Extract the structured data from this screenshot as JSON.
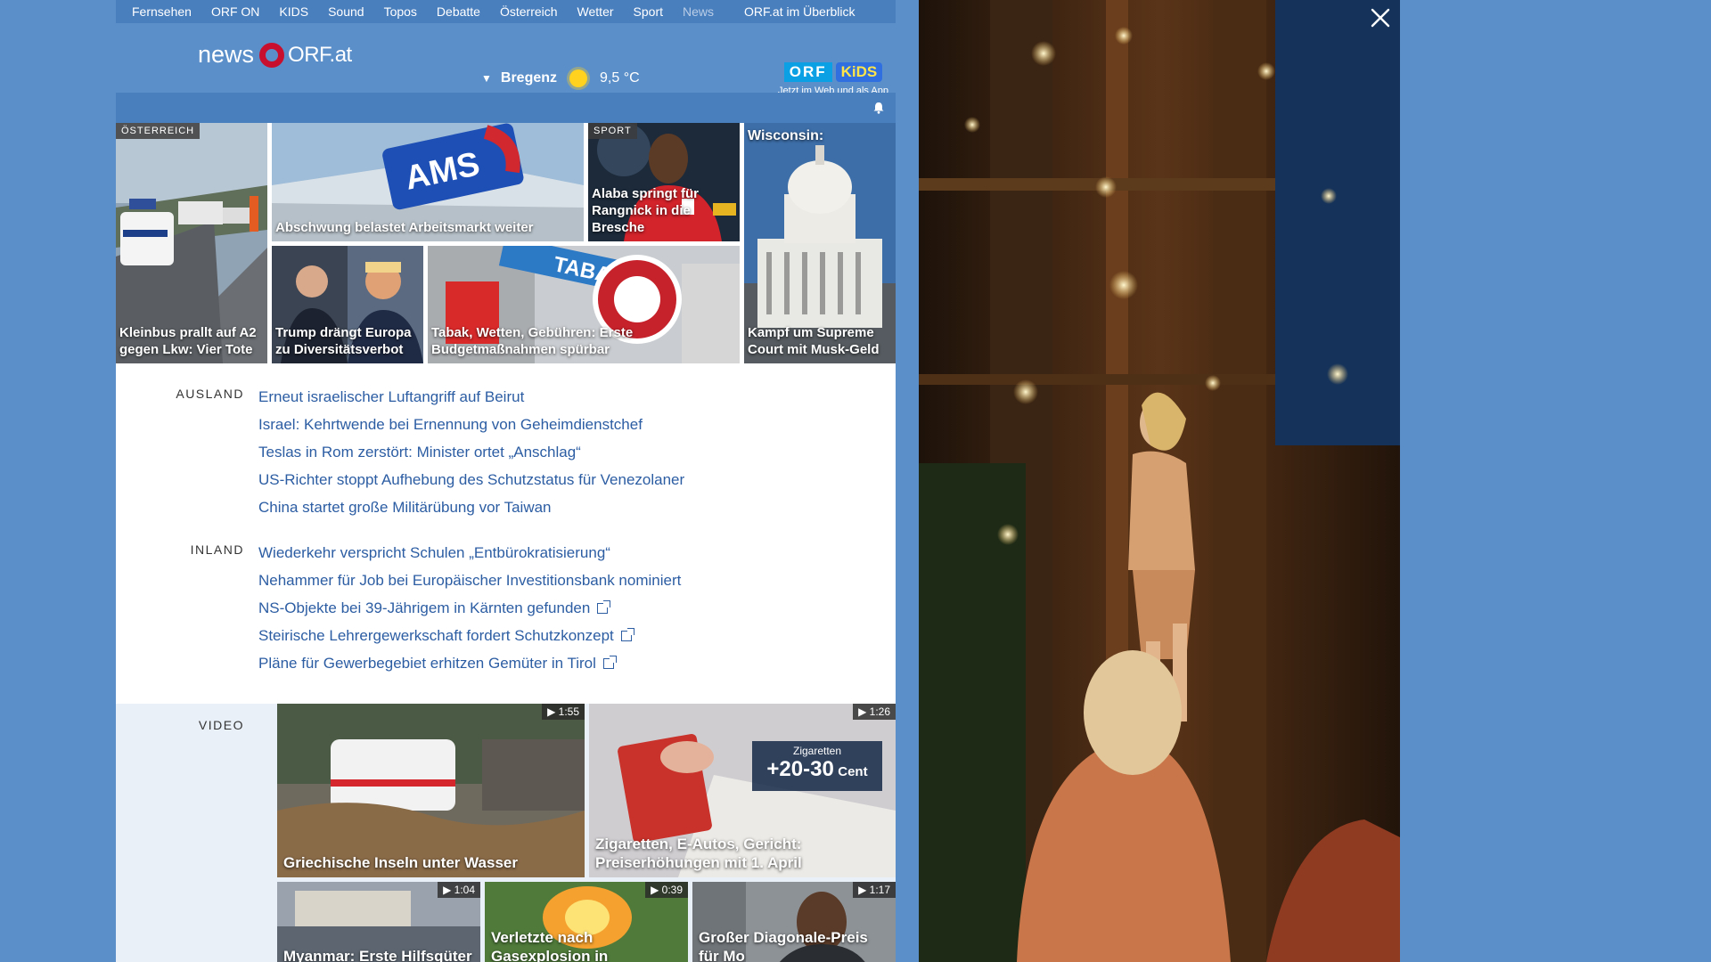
{
  "topnav": {
    "items": [
      "Fernsehen",
      "ORF ON",
      "KIDS",
      "Sound",
      "Topos",
      "Debatte",
      "Österreich",
      "Wetter",
      "Sport",
      "News"
    ],
    "active": "News",
    "overview": "ORF.at im Überblick"
  },
  "header": {
    "logo_news": "news",
    "logo_orf": "ORF.at",
    "weather": {
      "city": "Bregenz",
      "temperature": "9,5 °C",
      "icon": "sun-icon"
    },
    "kids": {
      "orf": "ORF",
      "kids": "KiDS",
      "text": "Jetzt im Web und als App"
    }
  },
  "tiles": [
    {
      "tag": "ÖSTERREICH",
      "title": "Kleinbus prallt auf A2 gegen Lkw: Vier Tote"
    },
    {
      "title": "Abschwung belastet Arbeitsmarkt weiter",
      "sign": "AMS"
    },
    {
      "tag": "SPORT",
      "title": "Alaba springt für Rangnick in die Bresche"
    },
    {
      "top_title": "Wisconsin:",
      "title": "Kampf um Supreme Court mit Musk-Geld"
    },
    {
      "title": "Trump drängt Europa zu Diversitätsverbot"
    },
    {
      "title": "Tabak, Wetten, Gebühren: Erste Budgetmaßnahmen spürbar",
      "sign": "TABAK"
    }
  ],
  "ausland": {
    "label": "AUSLAND",
    "items": [
      "Erneut israelischer Luftangriff auf Beirut",
      "Israel: Kehrtwende bei Ernennung von Geheimdienstchef",
      "Teslas in Rom zerstört: Minister ortet „Anschlag“",
      "US-Richter stoppt Aufhebung des Schutzstatus für Venezolaner",
      "China startet große Militärübung vor Taiwan"
    ]
  },
  "inland": {
    "label": "INLAND",
    "items": [
      {
        "text": "Wiederkehr verspricht Schulen „Entbürokratisierung“",
        "external": false
      },
      {
        "text": "Nehammer für Job bei Europäischer Investitionsbank nominiert",
        "external": false
      },
      {
        "text": "NS-Objekte bei 39-Jährigem in Kärnten gefunden",
        "external": true
      },
      {
        "text": "Steirische Lehrergewerkschaft fordert Schutzkonzept",
        "external": true
      },
      {
        "text": "Pläne für Gewerbegebiet erhitzen Gemüter in Tirol",
        "external": true
      }
    ]
  },
  "video": {
    "label": "VIDEO",
    "items": [
      {
        "duration": "1:55",
        "title": "Griechische Inseln unter Wasser"
      },
      {
        "duration": "1:26",
        "title": "Zigaretten, E-Autos, Gericht: Preiserhöhungen mit 1. April",
        "overlay_small": "Zigaretten",
        "overlay_big": "+20-30",
        "overlay_unit": "Cent"
      },
      {
        "duration": "1:04",
        "title": "Myanmar: Erste Hilfsgüter"
      },
      {
        "duration": "0:39",
        "title": "Verletzte nach Gasexplosion in"
      },
      {
        "duration": "1:17",
        "title": "Großer Diagonale-Preis für Mo"
      }
    ]
  },
  "colors": {
    "background": "#5b8fc9",
    "link": "#2c5da3",
    "logo_red": "#c8102e"
  }
}
